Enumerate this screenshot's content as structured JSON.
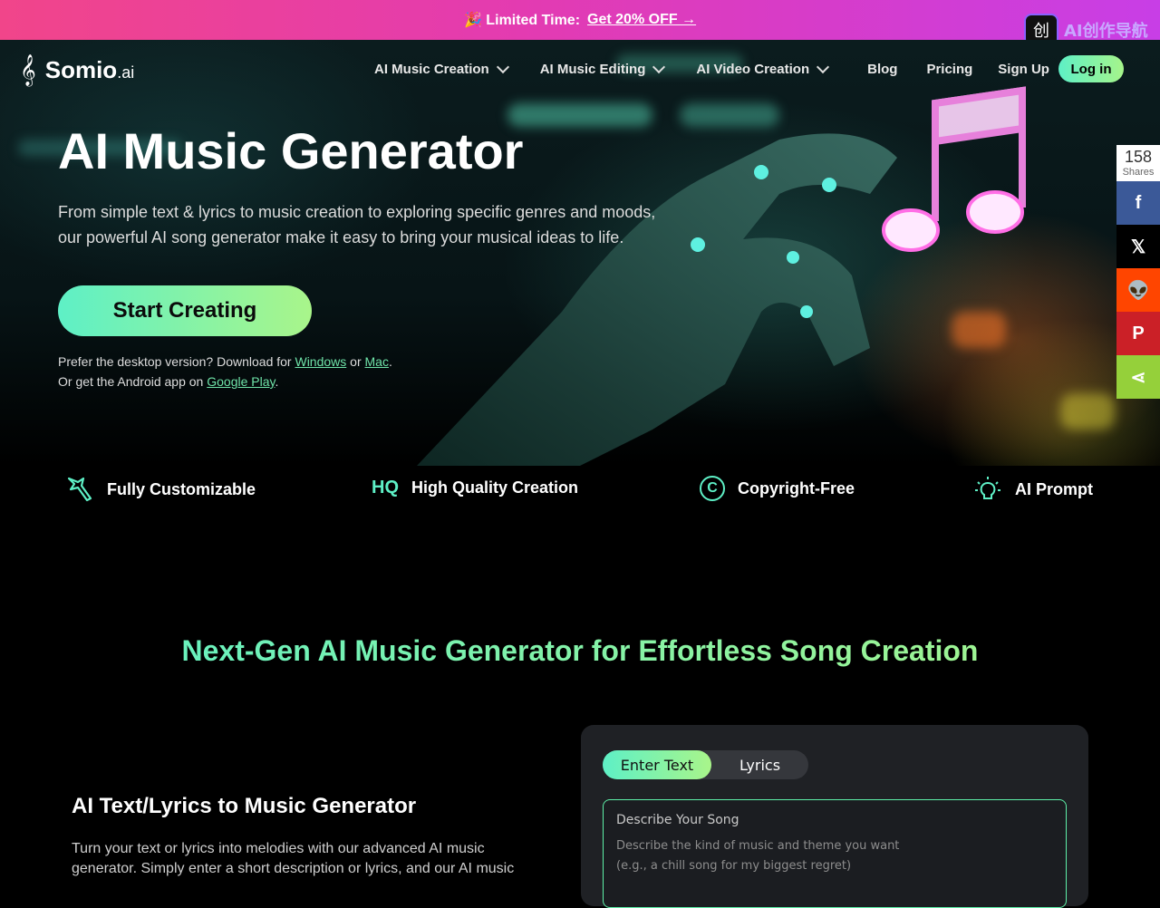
{
  "promo": {
    "label": "🎉 Limited Time:",
    "cta": "Get 20% OFF →"
  },
  "badge": {
    "icon": "创",
    "text": "AI创作导航"
  },
  "nav": {
    "logo_mark": "𝄞",
    "logo_name": "Somio",
    "logo_suffix": ".ai",
    "items": [
      {
        "label": "AI Music Creation",
        "dropdown": true
      },
      {
        "label": "AI Music Editing",
        "dropdown": true
      },
      {
        "label": "AI Video Creation",
        "dropdown": true
      },
      {
        "label": "Blog",
        "dropdown": false
      },
      {
        "label": "Pricing",
        "dropdown": false
      },
      {
        "label": "Sign Up",
        "dropdown": false
      }
    ],
    "login": "Log in"
  },
  "hero": {
    "title": "AI Music Generator",
    "subtitle": "From simple text & lyrics to music creation to exploring specific genres and moods, our powerful AI song generator make it easy to bring your musical ideas to life.",
    "cta": "Start Creating",
    "download_prefix": "Prefer the desktop version? Download for ",
    "windows": "Windows",
    "or": " or ",
    "mac": "Mac",
    "period": ".",
    "android_prefix": "Or get the Android app on ",
    "google_play": "Google Play",
    "period2": "."
  },
  "features": [
    {
      "icon": "magic-wand-icon",
      "label": "Fully Customizable"
    },
    {
      "icon": "hq-icon",
      "icon_text": "HQ",
      "label": "High Quality Creation"
    },
    {
      "icon": "copyright-icon",
      "icon_text": "©",
      "label": "Copyright-Free"
    },
    {
      "icon": "lightbulb-icon",
      "label": "AI Prompt"
    }
  ],
  "section": {
    "title": "Next-Gen AI Music Generator for Effortless Song Creation"
  },
  "generator": {
    "heading": "AI Text/Lyrics to Music Generator",
    "description": "Turn your text or lyrics into melodies with our advanced AI music generator. Simply enter a short description or lyrics, and our AI music",
    "tabs": [
      {
        "label": "Enter Text",
        "active": true
      },
      {
        "label": "Lyrics",
        "active": false
      }
    ],
    "field_label": "Describe Your Song",
    "field_hint": "Describe the kind of music and theme you want",
    "field_placeholder": "(e.g., a chill song for my biggest regret)"
  },
  "share": {
    "count": "158",
    "count_label": "Shares",
    "buttons": [
      {
        "name": "facebook",
        "glyph": "f",
        "color": "#3b5998"
      },
      {
        "name": "x",
        "glyph": "𝕏",
        "color": "#000000"
      },
      {
        "name": "reddit",
        "glyph": "👽",
        "color": "#ff4500"
      },
      {
        "name": "pinterest",
        "glyph": "P",
        "color": "#cb2027"
      },
      {
        "name": "sharethis",
        "glyph": "⋖",
        "color": "#95d03a"
      }
    ]
  },
  "colors": {
    "accent_start": "#5ef0c6",
    "accent_end": "#a9f58a",
    "promo_start": "#f1458a",
    "promo_end": "#c83ee6"
  }
}
